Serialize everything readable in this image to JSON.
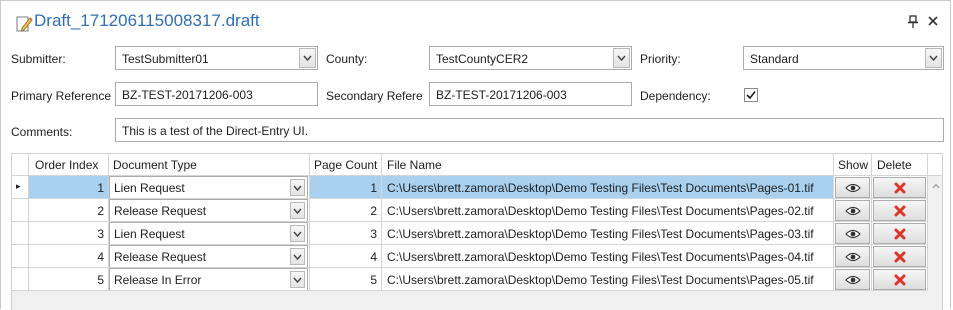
{
  "window": {
    "title": "Draft_171206115008317.draft",
    "pin_glyph": "⫫",
    "close_glyph": "✕"
  },
  "form": {
    "submitter": {
      "label": "Submitter:",
      "value": "TestSubmitter01"
    },
    "county": {
      "label": "County:",
      "value": "TestCountyCER2"
    },
    "priority": {
      "label": "Priority:",
      "value": "Standard"
    },
    "primary_reference": {
      "label": "Primary Reference",
      "value": "BZ-TEST-20171206-003"
    },
    "secondary_reference": {
      "label": "Secondary Referer",
      "value": "BZ-TEST-20171206-003"
    },
    "dependency": {
      "label": "Dependency:",
      "checked": true
    },
    "comments": {
      "label": "Comments:",
      "value": "This is a test of the Direct-Entry UI."
    }
  },
  "grid": {
    "columns": {
      "order_index": "Order Index",
      "document_type": "Document Type",
      "page_count": "Page Count",
      "file_name": "File Name",
      "show": "Show",
      "delete": "Delete"
    },
    "selected_row_marker": "▸",
    "rows": [
      {
        "order_index": "1",
        "document_type": "Lien Request",
        "page_count": "1",
        "file_name": "C:\\Users\\brett.zamora\\Desktop\\Demo Testing Files\\Test Documents\\Pages-01.tif"
      },
      {
        "order_index": "2",
        "document_type": "Release Request",
        "page_count": "2",
        "file_name": "C:\\Users\\brett.zamora\\Desktop\\Demo Testing Files\\Test Documents\\Pages-02.tif"
      },
      {
        "order_index": "3",
        "document_type": "Lien Request",
        "page_count": "3",
        "file_name": "C:\\Users\\brett.zamora\\Desktop\\Demo Testing Files\\Test Documents\\Pages-03.tif"
      },
      {
        "order_index": "4",
        "document_type": "Release Request",
        "page_count": "4",
        "file_name": "C:\\Users\\brett.zamora\\Desktop\\Demo Testing Files\\Test Documents\\Pages-04.tif"
      },
      {
        "order_index": "5",
        "document_type": "Release In Error",
        "page_count": "5",
        "file_name": "C:\\Users\\brett.zamora\\Desktop\\Demo Testing Files\\Test Documents\\Pages-05.tif"
      }
    ]
  },
  "icons": {
    "title": "document-edit-icon",
    "pin": "pin-icon",
    "close": "close-icon",
    "dropdown": "chevron-down-icon",
    "checkbox": "checkmark-icon",
    "show": "eye-icon",
    "delete": "red-x-icon",
    "scroll_up": "scroll-up-arrow-icon"
  },
  "colors": {
    "title": "#2e6fb5",
    "selected_row": "#a9d1ef",
    "delete_icon": "#d9352b",
    "border": "#ababab"
  }
}
